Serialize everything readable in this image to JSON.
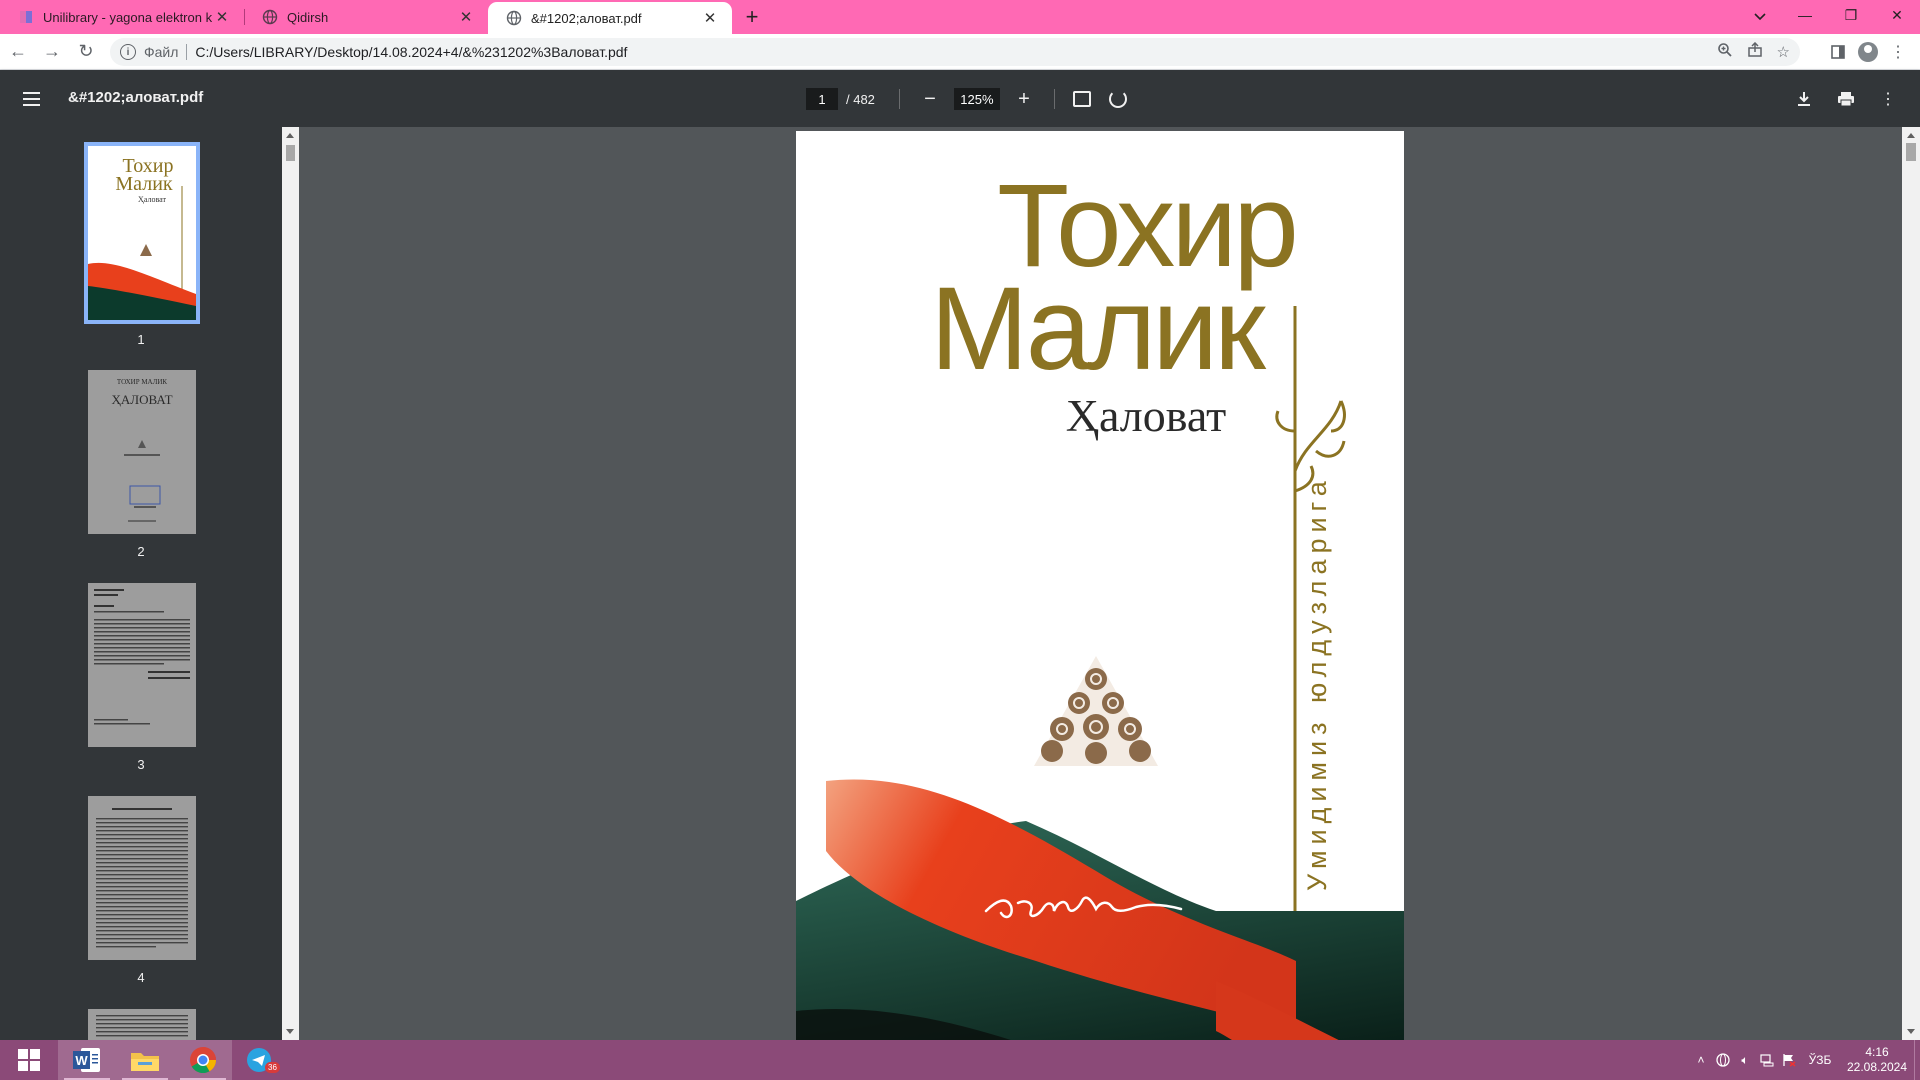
{
  "tabs": [
    {
      "title": "Unilibrary - yagona elektron kutu",
      "active": false
    },
    {
      "title": "Qidirsh",
      "active": false
    },
    {
      "title": "&#1202;аловат.pdf",
      "active": true
    }
  ],
  "omnibox": {
    "scheme": "Файл",
    "url": "C:/Users/LIBRARY/Desktop/14.08.2024+4/&%231202%3Валоват.pdf"
  },
  "pdf": {
    "filename": "&#1202;аловат.pdf",
    "current_page": "1",
    "total_pages": "/ 482",
    "zoom": "125%"
  },
  "thumbnails": [
    {
      "number": "1"
    },
    {
      "number": "2"
    },
    {
      "number": "3"
    },
    {
      "number": "4"
    }
  ],
  "cover": {
    "author_line1": "Тохир",
    "author_line2": "Малик",
    "title": "Ҳаловат",
    "series": "Умидимиз юлдузларига",
    "gold": "#8b7322",
    "red": "#e8401c",
    "green": "#0c3a2c"
  },
  "thumb_text": {
    "t1_line1": "Тохир",
    "t1_line2": "Малик",
    "t1_title": "Ҳаловат",
    "t2_author": "ТОХИР МАЛИК",
    "t2_title": "ҲАЛОВАТ"
  },
  "taskbar": {
    "telegram_badge": "36",
    "lang": "ЎЗБ",
    "time": "4:16",
    "date": "22.08.2024"
  }
}
